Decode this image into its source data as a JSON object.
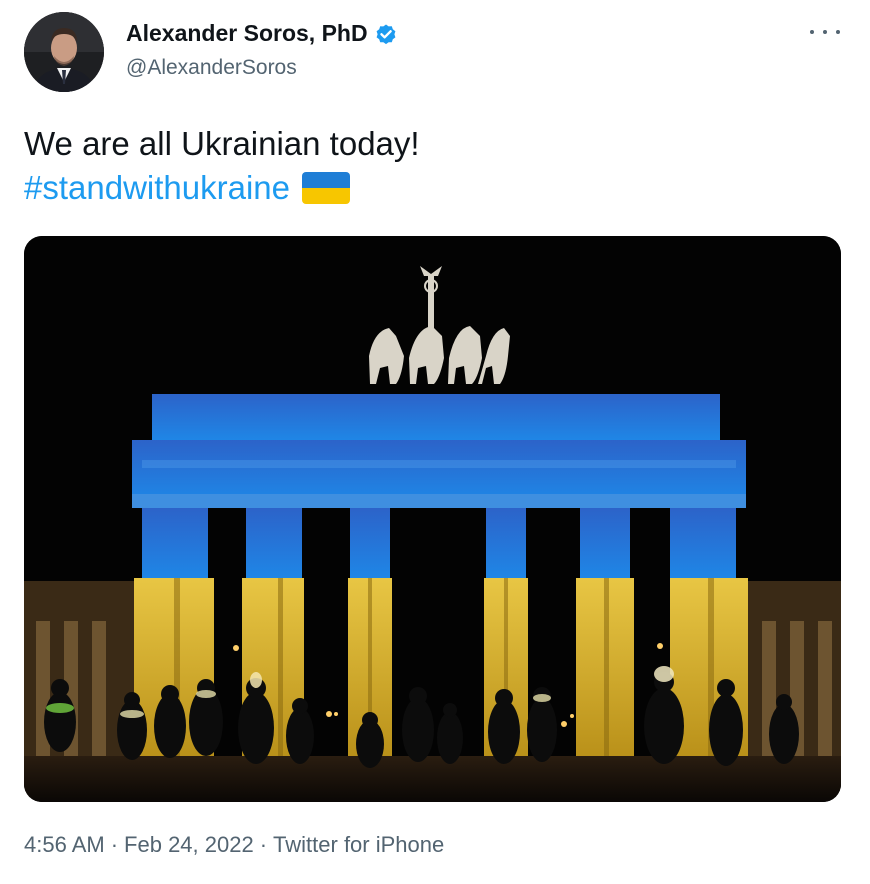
{
  "author": {
    "display_name": "Alexander Soros, PhD",
    "handle": "@AlexanderSoros",
    "verified_icon": "verified-badge-icon",
    "avatar_icon": "avatar-portrait"
  },
  "tweet": {
    "text": "We are all Ukrainian today!",
    "hashtag": "#standwithukraine",
    "emoji": "flag-ukraine",
    "media_icon": "brandenburg-gate-photo"
  },
  "footer": {
    "time": "4:56 AM",
    "separator": "·",
    "date": "Feb 24, 2022",
    "source": "Twitter for iPhone"
  },
  "colors": {
    "link": "#1d9bf0",
    "text": "#0f1419",
    "muted": "#536471",
    "verified": "#1d9bf0",
    "ukraine_blue": "#1f7ed6",
    "ukraine_yellow": "#f7c600"
  },
  "more_menu_icon": "more-horizontal-icon"
}
